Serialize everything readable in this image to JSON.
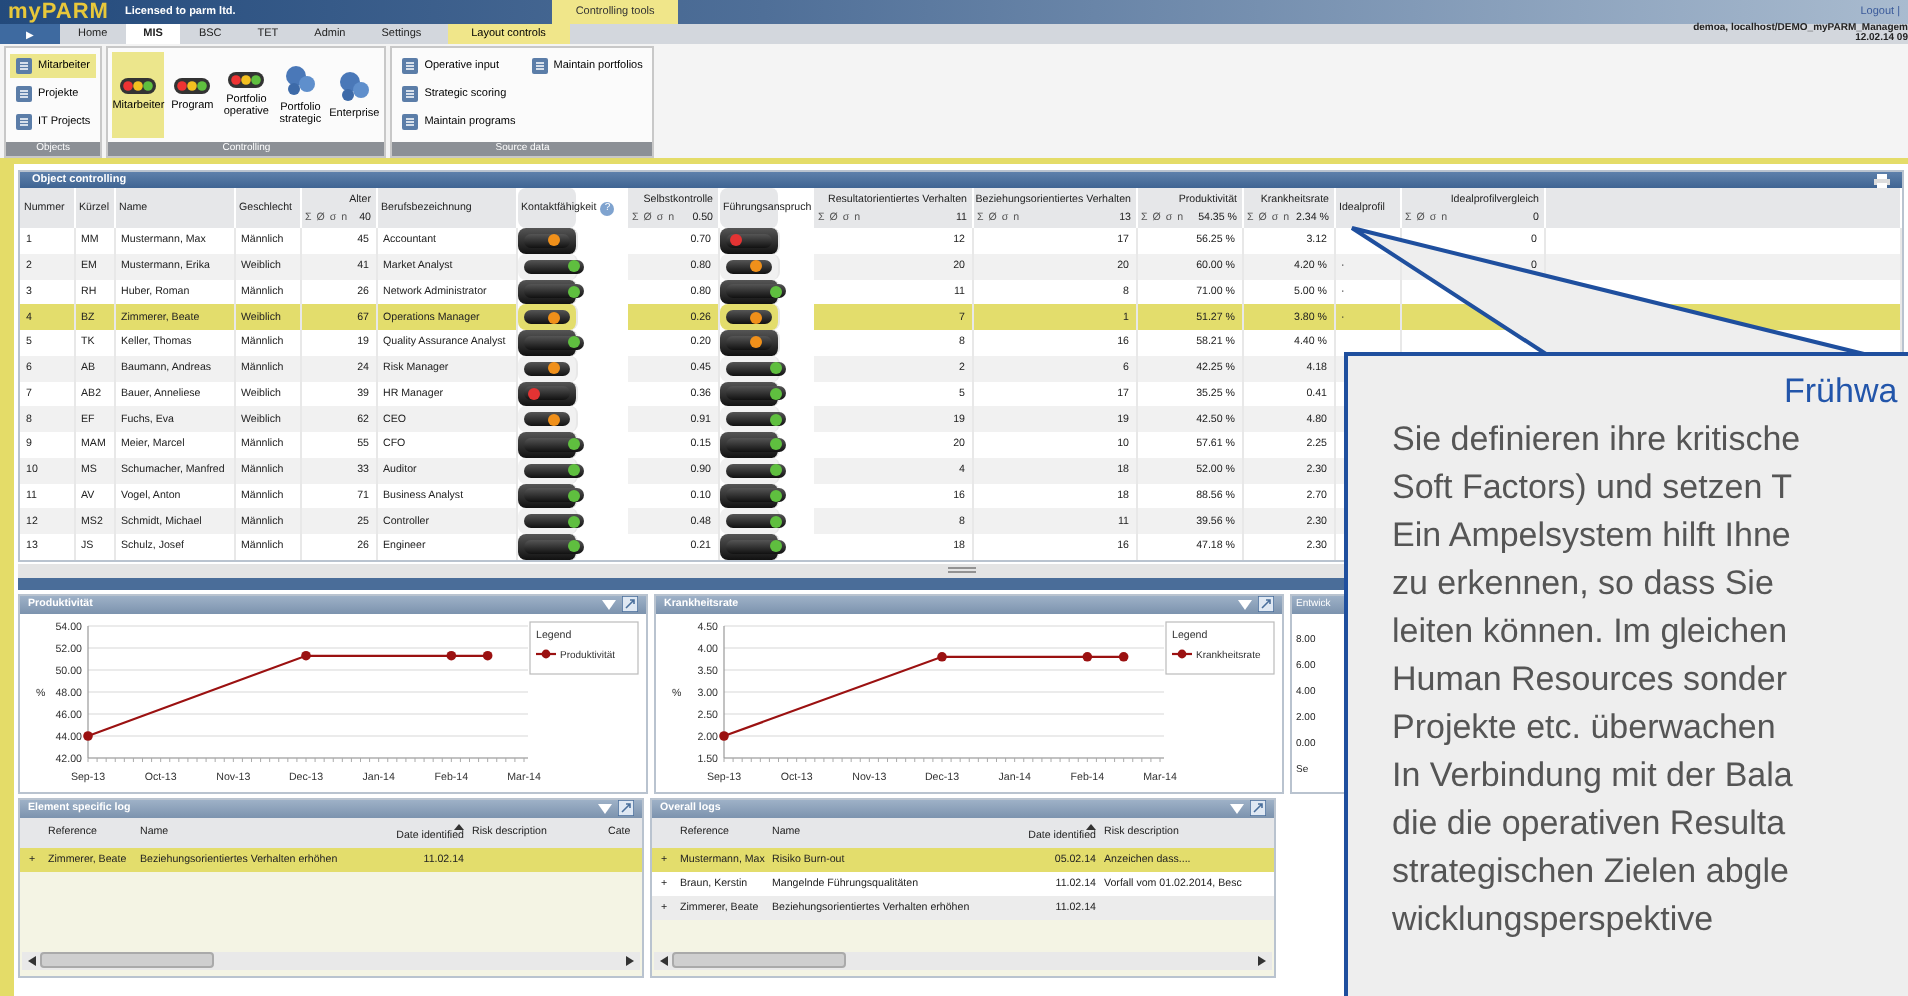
{
  "header": {
    "logo": "myPARM",
    "license": "Licensed to parm ltd.",
    "context_tab": "Controlling tools",
    "logout": "Logout |"
  },
  "nav": {
    "menu_button": "▶",
    "tabs": [
      {
        "label": "Home",
        "selected": false
      },
      {
        "label": "MIS",
        "selected": true
      },
      {
        "label": "BSC",
        "selected": false
      },
      {
        "label": "TET",
        "selected": false
      },
      {
        "label": "Admin",
        "selected": false
      },
      {
        "label": "Settings",
        "selected": false
      }
    ],
    "context_tab": "Layout controls",
    "user": "demoa, localhost/DEMO_myPARM_Managem",
    "date": "12.02.14 09"
  },
  "ribbon": {
    "groups": [
      {
        "label": "Objects",
        "kind": "list",
        "items": [
          {
            "label": "Mitarbeiter",
            "selected": true
          },
          {
            "label": "Projekte",
            "selected": false
          },
          {
            "label": "IT Projects",
            "selected": false
          }
        ]
      },
      {
        "label": "Controlling",
        "kind": "large",
        "items": [
          {
            "label": "Mitarbeiter",
            "kind": "lights",
            "selected": true
          },
          {
            "label": "Program",
            "kind": "lights",
            "selected": false
          },
          {
            "label": "Portfolio operative",
            "kind": "lights",
            "selected": false
          },
          {
            "label": "Portfolio strategic",
            "kind": "bubbles",
            "selected": false
          },
          {
            "label": "Enterprise",
            "kind": "bubbles",
            "selected": false
          }
        ]
      },
      {
        "label": "Source data",
        "kind": "list",
        "items": [
          {
            "label": "Operative input",
            "selected": false
          },
          {
            "label": "Strategic scoring",
            "selected": false
          },
          {
            "label": "Maintain programs",
            "selected": false
          },
          {
            "label": "Maintain portfolios",
            "selected": false
          }
        ]
      }
    ]
  },
  "table": {
    "title": "Object controlling",
    "columns": [
      {
        "label": "Nummer",
        "kind": "text"
      },
      {
        "label": "Kürzel",
        "kind": "text"
      },
      {
        "label": "Name",
        "kind": "text"
      },
      {
        "label": "Geschlecht",
        "kind": "text"
      },
      {
        "label": "Alter",
        "kind": "number",
        "summary": {
          "symbols": "Σ Ø σ n",
          "value": "40"
        }
      },
      {
        "label": "Berufsbezeichnung",
        "kind": "text"
      },
      {
        "label": "Kontaktfähigkeit",
        "kind": "light",
        "help": "?"
      },
      {
        "label": "Selbstkontrolle",
        "kind": "number",
        "summary": {
          "symbols": "Σ Ø σ n",
          "value": "0.50"
        }
      },
      {
        "label": "Führungsanspruch",
        "kind": "light"
      },
      {
        "label": "Resultatorientiertes Verhalten",
        "kind": "number",
        "summary": {
          "symbols": "Σ Ø σ n",
          "value": "11"
        }
      },
      {
        "label": "Beziehungsorientiertes Verhalten",
        "kind": "number",
        "summary": {
          "symbols": "Σ Ø σ n",
          "value": "13"
        }
      },
      {
        "label": "Produktivität",
        "kind": "number",
        "summary": {
          "symbols": "Σ Ø σ n",
          "value": "54.35 %"
        }
      },
      {
        "label": "Krankheitsrate",
        "kind": "number",
        "summary": {
          "symbols": "Σ Ø σ n",
          "value": "2.34 %"
        }
      },
      {
        "label": "Idealprofil",
        "kind": "text"
      },
      {
        "label": "Idealprofilvergleich",
        "kind": "number",
        "summary": {
          "symbols": "Σ Ø σ n",
          "value": "0"
        }
      }
    ],
    "rows": [
      {
        "selected": false,
        "cells": [
          "1",
          "MM",
          "Mustermann, Max",
          "Männlich",
          "45",
          "Accountant",
          {
            "color": "#f0901a"
          },
          "0.70",
          {
            "color": "#e33333"
          },
          "12",
          "17",
          "56.25 %",
          "3.12"
        ],
        "extra": {
          "col14": "0"
        }
      },
      {
        "selected": false,
        "cells": [
          "2",
          "EM",
          "Mustermann, Erika",
          "Weiblich",
          "41",
          "Market Analyst",
          {
            "color": "#5fbf3f"
          },
          "0.80",
          {
            "color": "#f0901a"
          },
          "20",
          "20",
          "60.00 %",
          "4.20 %"
        ],
        "extra": {
          "col13": "·",
          "col14": "0"
        }
      },
      {
        "selected": false,
        "cells": [
          "3",
          "RH",
          "Huber, Roman",
          "Männlich",
          "26",
          "Network Administrator",
          {
            "color": "#5fbf3f"
          },
          "0.80",
          {
            "color": "#5fbf3f"
          },
          "11",
          "8",
          "71.00 %",
          "5.00 %"
        ],
        "extra": {
          "col13": "·"
        }
      },
      {
        "selected": true,
        "cells": [
          "4",
          "BZ",
          "Zimmerer, Beate",
          "Weiblich",
          "67",
          "Operations Manager",
          {
            "color": "#f0901a"
          },
          "0.26",
          {
            "color": "#f0901a"
          },
          "7",
          "1",
          "51.27 %",
          "3.80 %"
        ],
        "extra": {
          "col13": "·"
        }
      },
      {
        "selected": false,
        "cells": [
          "5",
          "TK",
          "Keller, Thomas",
          "Männlich",
          "19",
          "Quality Assurance Analyst",
          {
            "color": "#5fbf3f"
          },
          "0.20",
          {
            "color": "#f0901a"
          },
          "8",
          "16",
          "58.21 %",
          "4.40 %"
        ]
      },
      {
        "selected": false,
        "cells": [
          "6",
          "AB",
          "Baumann, Andreas",
          "Männlich",
          "24",
          "Risk Manager",
          {
            "color": "#f0901a"
          },
          "0.45",
          {
            "color": "#5fbf3f"
          },
          "2",
          "6",
          "42.25 %",
          "4.18"
        ]
      },
      {
        "selected": false,
        "cells": [
          "7",
          "AB2",
          "Bauer, Anneliese",
          "Weiblich",
          "39",
          "HR Manager",
          {
            "color": "#e33333"
          },
          "0.36",
          {
            "color": "#5fbf3f"
          },
          "5",
          "17",
          "35.25 %",
          "0.41"
        ]
      },
      {
        "selected": false,
        "cells": [
          "8",
          "EF",
          "Fuchs, Eva",
          "Weiblich",
          "62",
          "CEO",
          {
            "color": "#f0901a"
          },
          "0.91",
          {
            "color": "#5fbf3f"
          },
          "19",
          "19",
          "42.50 %",
          "4.80"
        ]
      },
      {
        "selected": false,
        "cells": [
          "9",
          "MAM",
          "Meier, Marcel",
          "Männlich",
          "55",
          "CFO",
          {
            "color": "#5fbf3f"
          },
          "0.15",
          {
            "color": "#5fbf3f"
          },
          "20",
          "10",
          "57.61 %",
          "2.25"
        ]
      },
      {
        "selected": false,
        "cells": [
          "10",
          "MS",
          "Schumacher, Manfred",
          "Männlich",
          "33",
          "Auditor",
          {
            "color": "#5fbf3f"
          },
          "0.90",
          {
            "color": "#5fbf3f"
          },
          "4",
          "18",
          "52.00 %",
          "2.30"
        ]
      },
      {
        "selected": false,
        "cells": [
          "11",
          "AV",
          "Vogel, Anton",
          "Männlich",
          "71",
          "Business Analyst",
          {
            "color": "#5fbf3f"
          },
          "0.10",
          {
            "color": "#5fbf3f"
          },
          "16",
          "18",
          "88.56 %",
          "2.70"
        ]
      },
      {
        "selected": false,
        "cells": [
          "12",
          "MS2",
          "Schmidt, Michael",
          "Männlich",
          "25",
          "Controller",
          {
            "color": "#5fbf3f"
          },
          "0.48",
          {
            "color": "#5fbf3f"
          },
          "8",
          "11",
          "39.56 %",
          "2.30"
        ]
      },
      {
        "selected": false,
        "cells": [
          "13",
          "JS",
          "Schulz, Josef",
          "Männlich",
          "26",
          "Engineer",
          {
            "color": "#5fbf3f"
          },
          "0.21",
          {
            "color": "#5fbf3f"
          },
          "18",
          "16",
          "47.18 %",
          "2.30"
        ]
      }
    ]
  },
  "charts": [
    {
      "title": "Produktivität",
      "legend_title": "Legend",
      "chart_data": {
        "type": "line",
        "ylabel": "%",
        "categories": [
          "Sep-13",
          null,
          "Oct-13",
          null,
          "Nov-13",
          null,
          "Dec-13",
          null,
          "Jan-14",
          null,
          "Feb-14",
          null,
          "Mar-14"
        ],
        "grid": true,
        "series": [
          {
            "name": "Produktivität",
            "color": "#9b1111",
            "marker": true,
            "values": [
              44.0,
              null,
              null,
              null,
              null,
              null,
              51.3,
              null,
              null,
              null,
              51.3,
              51.3,
              null
            ]
          }
        ],
        "ylim": [
          42,
          54
        ],
        "yticks": [
          {
            "value": 42,
            "label": "42.00"
          },
          {
            "value": 44,
            "label": "44.00"
          },
          {
            "value": 46,
            "label": "46.00"
          },
          {
            "value": 48,
            "label": "48.00"
          },
          {
            "value": 50,
            "label": "50.00"
          },
          {
            "value": 52,
            "label": "52.00"
          },
          {
            "value": 54,
            "label": "54.00"
          }
        ]
      }
    },
    {
      "title": "Krankheitsrate",
      "legend_title": "Legend",
      "chart_data": {
        "type": "line",
        "ylabel": "%",
        "categories": [
          "Sep-13",
          null,
          "Oct-13",
          null,
          "Nov-13",
          null,
          "Dec-13",
          null,
          "Jan-14",
          null,
          "Feb-14",
          null,
          "Mar-14"
        ],
        "grid": true,
        "series": [
          {
            "name": "Krankheitsrate",
            "color": "#9b1111",
            "marker": true,
            "values": [
              2.0,
              null,
              null,
              null,
              null,
              null,
              3.8,
              null,
              null,
              null,
              3.8,
              3.8,
              null
            ]
          }
        ],
        "ylim": [
          1.5,
          4.5
        ],
        "yticks": [
          {
            "value": 1.5,
            "label": "1.50"
          },
          {
            "value": 2,
            "label": "2.00"
          },
          {
            "value": 2.5,
            "label": "2.50"
          },
          {
            "value": 3,
            "label": "3.00"
          },
          {
            "value": 3.5,
            "label": "3.50"
          },
          {
            "value": 4,
            "label": "4.00"
          },
          {
            "value": 4.5,
            "label": "4.50"
          }
        ]
      }
    }
  ],
  "partial_chart": {
    "title": "Entwick",
    "tick_labels": [
      "8.00",
      "6.00",
      "4.00",
      "2.00",
      "0.00"
    ],
    "x_label": "Se"
  },
  "logs": [
    {
      "title": "Element specific log",
      "columns": [
        "Reference",
        "Name",
        "Date identified",
        "Risk description",
        "Cate"
      ],
      "rows": [
        {
          "selected": true,
          "expander": "+",
          "reference": "Zimmerer, Beate",
          "name": "Beziehungsorientiertes Verhalten erhöhen",
          "date": "11.02.14"
        }
      ]
    },
    {
      "title": "Overall logs",
      "columns": [
        "Reference",
        "Name",
        "Date identified",
        "Risk description"
      ],
      "rows": [
        {
          "selected": true,
          "expander": "+",
          "reference": "Mustermann, Max",
          "name": "Risiko Burn-out",
          "date": "05.02.14",
          "risk": "Anzeichen dass...."
        },
        {
          "selected": false,
          "expander": "+",
          "reference": "Braun, Kerstin",
          "name": "Mangelnde Führungsqualitäten",
          "date": "11.02.14",
          "risk": "Vorfall vom 01.02.2014, Besc"
        },
        {
          "selected": false,
          "expander": "+",
          "reference": "Zimmerer, Beate",
          "name": "Beziehungsorientiertes Verhalten erhöhen",
          "date": "11.02.14"
        }
      ]
    }
  ],
  "callout": {
    "title": "Frühwa",
    "lines": [
      "Sie definieren ihre kritische",
      "Soft Factors) und setzen T",
      "Ein Ampelsystem hilft Ihne",
      "zu erkennen, so dass Sie",
      "leiten können. Im gleichen",
      "Human Resources sonder",
      "Projekte etc. überwachen",
      "In Verbindung mit der Bala",
      "die die operativen Resulta",
      "strategischen Zielen abgle",
      "wicklungsperspektive"
    ]
  }
}
